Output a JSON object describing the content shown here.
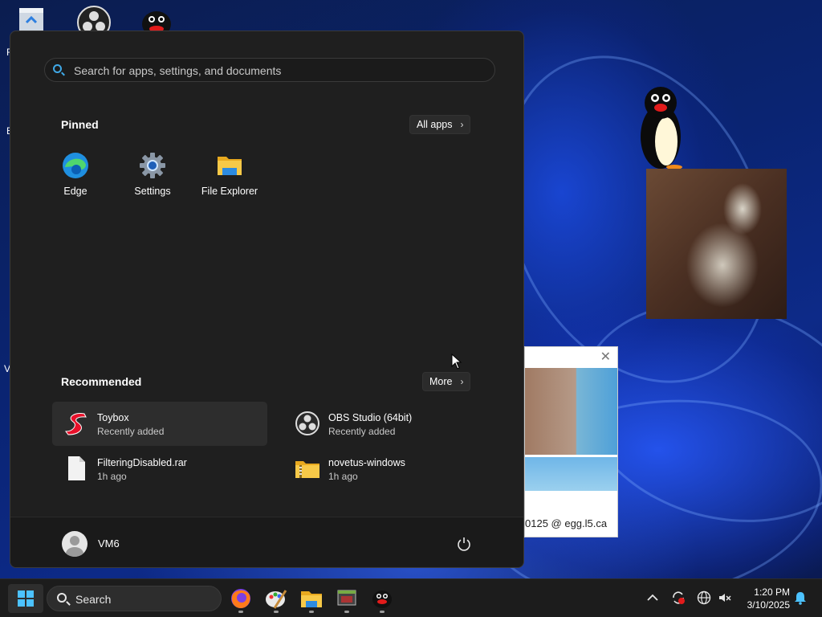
{
  "start_menu": {
    "search_placeholder": "Search for apps, settings, and documents",
    "pinned_title": "Pinned",
    "all_apps_label": "All apps",
    "pinned_apps": [
      {
        "label": "Edge",
        "icon": "edge-icon"
      },
      {
        "label": "Settings",
        "icon": "gear-icon"
      },
      {
        "label": "File Explorer",
        "icon": "folder-icon"
      }
    ],
    "recommended_title": "Recommended",
    "more_label": "More",
    "recommended": [
      {
        "name": "Toybox",
        "sub": "Recently added",
        "icon": "toybox-icon"
      },
      {
        "name": "OBS Studio (64bit)",
        "sub": "Recently added",
        "icon": "obs-icon"
      },
      {
        "name": "FilteringDisabled.rar",
        "sub": "1h ago",
        "icon": "file-icon"
      },
      {
        "name": "novetus-windows",
        "sub": "1h ago",
        "icon": "zip-folder-icon"
      }
    ],
    "user": "VM6"
  },
  "desktop": {
    "window_caption": "0125 @ egg.l5.ca"
  },
  "taskbar": {
    "search_label": "Search",
    "time": "1:20 PM",
    "date": "3/10/2025"
  },
  "colors": {
    "accent": "#4cc2ff",
    "menu_bg": "#1f1f1f",
    "taskbar_bg": "#1c1c1c"
  }
}
